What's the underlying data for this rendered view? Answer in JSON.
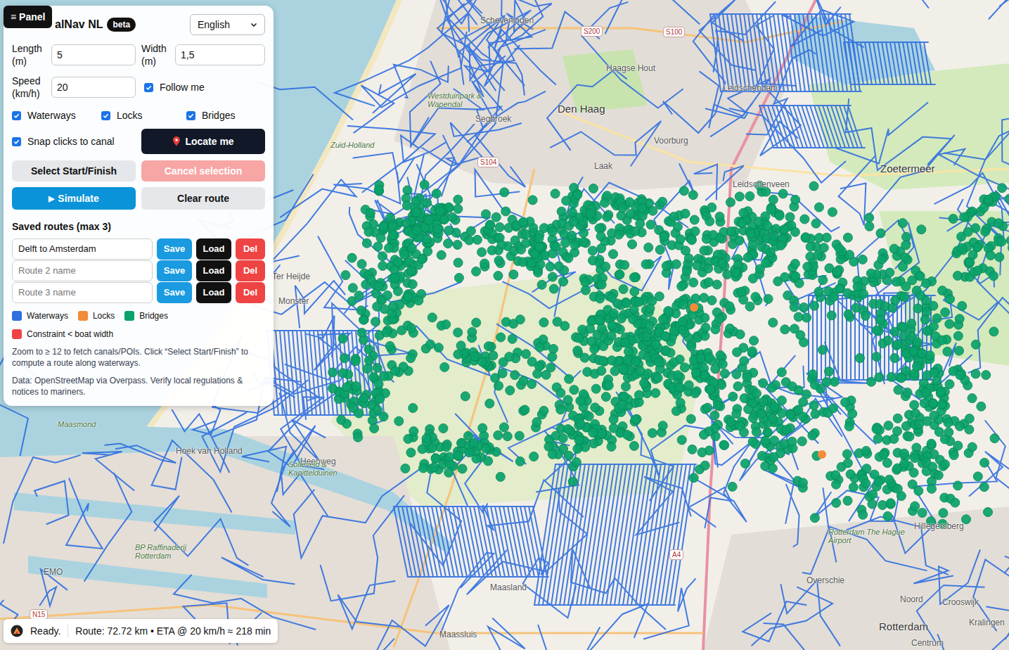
{
  "panel_toggle": "≡ Panel",
  "header": {
    "title": "alNav NL",
    "badge": "beta",
    "language": "English"
  },
  "fields": [
    {
      "label": "Length (m)",
      "value": "5"
    },
    {
      "label": "Width (m)",
      "value": "1,5"
    },
    {
      "label": "Speed (km/h)",
      "value": "20"
    }
  ],
  "follow_me": {
    "label": "Follow me",
    "checked": true
  },
  "layers": [
    {
      "label": "Waterways",
      "checked": true
    },
    {
      "label": "Locks",
      "checked": true
    },
    {
      "label": "Bridges",
      "checked": true
    }
  ],
  "snap": {
    "label": "Snap clicks to canal",
    "checked": true
  },
  "locate_button": "Locate me",
  "selection_buttons": [
    {
      "label": "Select Start/Finish",
      "disabled": false
    },
    {
      "label": "Cancel selection",
      "disabled": true
    }
  ],
  "simulate": {
    "icon": "▶",
    "label": "Simulate"
  },
  "clear_button": "Clear route",
  "saved_routes": {
    "title": "Saved routes (max 3)",
    "row_buttons": [
      "Save",
      "Load",
      "Del"
    ],
    "rows": [
      {
        "value": "Delft to Amsterdam",
        "placeholder": ""
      },
      {
        "value": "",
        "placeholder": "Route 2 name"
      },
      {
        "value": "",
        "placeholder": "Route 3 name"
      }
    ]
  },
  "legend": [
    {
      "label": "Waterways",
      "color": "#2f6fe0"
    },
    {
      "label": "Locks",
      "color": "#f28c38"
    },
    {
      "label": "Bridges",
      "color": "#0aa36b"
    },
    {
      "label": "Constraint < boat width",
      "color": "#ef4444"
    }
  ],
  "help": "Zoom to ≥ 12 to fetch canals/POIs. Click “Select Start/Finish” to compute a route along waterways.",
  "source": "Data: OpenStreetMap via Overpass. Verify local regulations & notices to mariners.",
  "status_bar": {
    "state": "Ready.",
    "route": "Route: 72.72 km • ETA @ 20 km/h ≈ 218 min"
  },
  "map_labels": [
    {
      "text": "Scheveningen",
      "kind": "place"
    },
    {
      "text": "S200",
      "kind": "road"
    },
    {
      "text": "S100",
      "kind": "road"
    },
    {
      "text": "Haagse Hout",
      "kind": "place"
    },
    {
      "text": "Leidschendam",
      "kind": "place"
    },
    {
      "text": "Den Haag",
      "kind": "city"
    },
    {
      "text": "Segbroek",
      "kind": "place"
    },
    {
      "text": "Westduinpark & Wapendal",
      "kind": "area"
    },
    {
      "text": "Zuid-Holland",
      "kind": "area"
    },
    {
      "text": "Voorburg",
      "kind": "place"
    },
    {
      "text": "Zoetermeer",
      "kind": "city"
    },
    {
      "text": "S104",
      "kind": "road"
    },
    {
      "text": "Laak",
      "kind": "place"
    },
    {
      "text": "Leidschenveen",
      "kind": "place"
    },
    {
      "text": "Ter Heijde",
      "kind": "place"
    },
    {
      "text": "Monster",
      "kind": "place"
    },
    {
      "text": "Hoek van Holland",
      "kind": "place"
    },
    {
      "text": "Maasmond",
      "kind": "area"
    },
    {
      "text": "Heenweg",
      "kind": "place"
    },
    {
      "text": "Solleveld & Kapittelduinen",
      "kind": "area"
    },
    {
      "text": "BP Raffinaderij Rotterdam",
      "kind": "area"
    },
    {
      "text": "EMO",
      "kind": "place"
    },
    {
      "text": "N15",
      "kind": "road"
    },
    {
      "text": "A4",
      "kind": "road"
    },
    {
      "text": "Maasland",
      "kind": "place"
    },
    {
      "text": "Overschie",
      "kind": "place"
    },
    {
      "text": "Rotterdam The Hague Airport",
      "kind": "area"
    },
    {
      "text": "Hillegersberg",
      "kind": "place"
    },
    {
      "text": "Noord",
      "kind": "place"
    },
    {
      "text": "Crooswijk",
      "kind": "place"
    },
    {
      "text": "Kralingen",
      "kind": "place"
    },
    {
      "text": "Rotterdam",
      "kind": "city"
    },
    {
      "text": "Maassluis",
      "kind": "place"
    },
    {
      "text": "Centrum",
      "kind": "place"
    }
  ]
}
